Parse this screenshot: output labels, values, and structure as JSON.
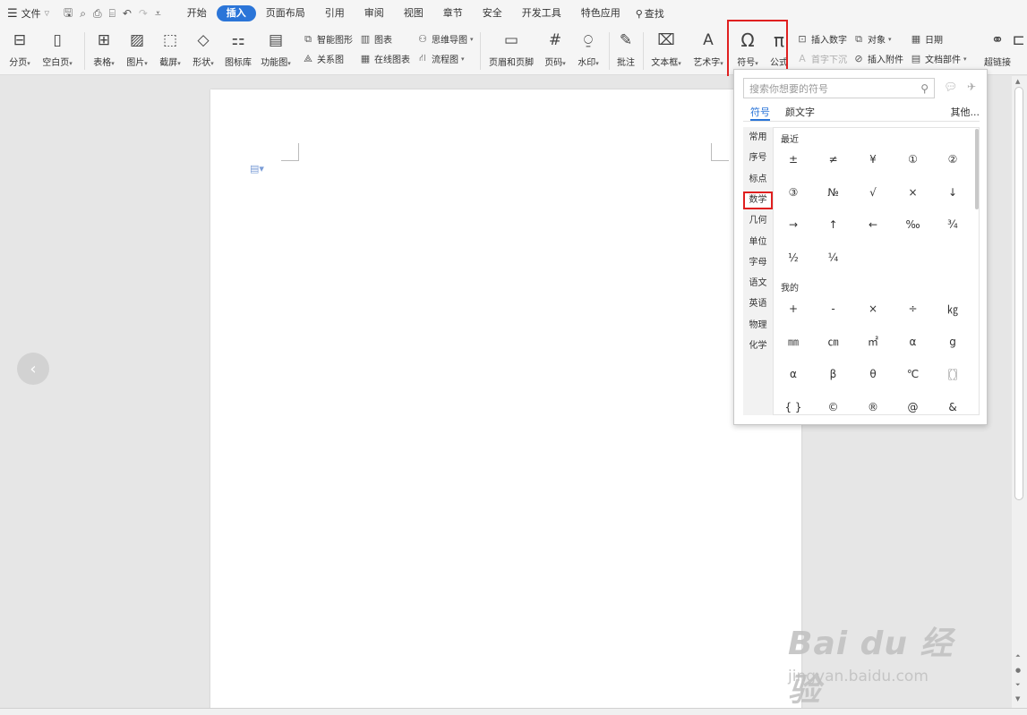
{
  "menubar": {
    "file_label": "文件",
    "tabs": [
      "开始",
      "插入",
      "页面布局",
      "引用",
      "审阅",
      "视图",
      "章节",
      "安全",
      "开发工具",
      "特色应用"
    ],
    "active_tab": "插入",
    "search_label": "查找"
  },
  "ribbon": {
    "page_break": "分页",
    "blank_page": "空白页",
    "table": "表格",
    "picture": "图片",
    "screenshot": "截屏",
    "shape": "形状",
    "icon_lib": "图标库",
    "func_chart": "功能图",
    "smart_shape": "智能图形",
    "chart": "图表",
    "mindmap": "思维导图",
    "relation": "关系图",
    "online_chart": "在线图表",
    "flowchart": "流程图",
    "header_footer": "页眉和页脚",
    "page_num": "页码",
    "watermark": "水印",
    "comment": "批注",
    "textbox": "文本框",
    "wordart": "艺术字",
    "symbol": "符号",
    "formula": "公式",
    "insert_number": "插入数字",
    "object": "对象",
    "date": "日期",
    "drop_cap": "首字下沉",
    "attachment": "插入附件",
    "doc_parts": "文档部件",
    "hyperlink": "超链接"
  },
  "symbol_panel": {
    "search_placeholder": "搜索你想要的符号",
    "tabs": [
      "符号",
      "颜文字"
    ],
    "other": "其他...",
    "categories": [
      "常用",
      "序号",
      "标点",
      "数学",
      "几何",
      "单位",
      "字母",
      "语文",
      "英语",
      "物理",
      "化学"
    ],
    "selected_category": "数学",
    "recent_title": "最近",
    "recent": [
      "±",
      "≠",
      "¥",
      "①",
      "②",
      "③",
      "№",
      "√",
      "×",
      "↓",
      "→",
      "↑",
      "←",
      "‰",
      "¾",
      "½",
      "¼"
    ],
    "mine_title": "我的",
    "mine": [
      "+",
      "-",
      "×",
      "÷",
      "㎏",
      "㎜",
      "㎝",
      "㎡",
      "α",
      "g",
      "α",
      "β",
      "θ",
      "℃",
      "〖〗",
      "{ }",
      "©",
      "®",
      "@",
      "&"
    ]
  },
  "watermark": {
    "main": "Bai du 经验",
    "sub": "jingyan.baidu.com"
  },
  "colors": {
    "accent": "#2b75d8",
    "highlight": "#e02020"
  }
}
